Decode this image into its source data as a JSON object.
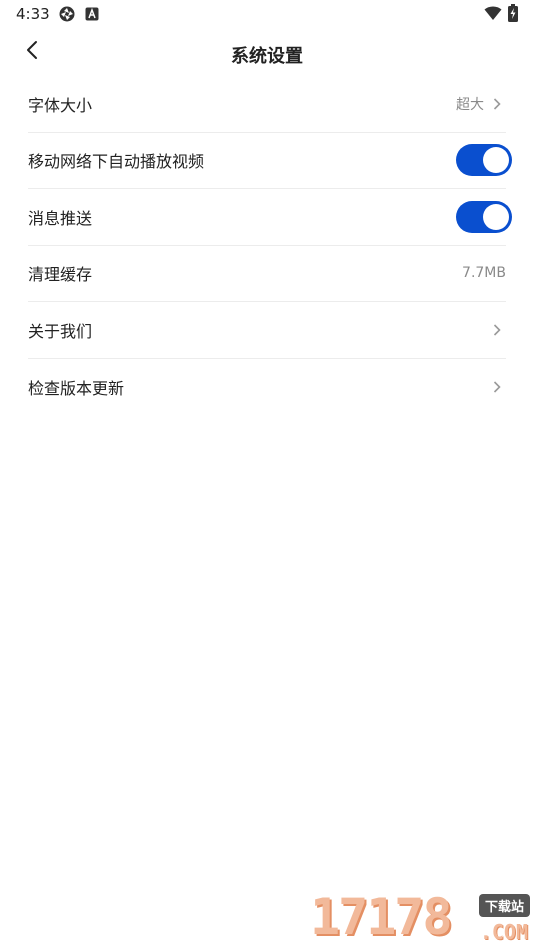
{
  "status_bar": {
    "time": "4:33",
    "icons": [
      "aperture-icon",
      "a-badge-icon",
      "wifi-icon",
      "battery-charging-icon"
    ]
  },
  "header": {
    "back_icon": "chevron-left-icon",
    "title": "系统设置"
  },
  "settings": {
    "items": [
      {
        "label": "字体大小",
        "value": "超大",
        "control": "chevron"
      },
      {
        "label": "移动网络下自动播放视频",
        "control": "toggle",
        "on": true
      },
      {
        "label": "消息推送",
        "control": "toggle",
        "on": true
      },
      {
        "label": "清理缓存",
        "value": "7.7MB",
        "control": "value"
      },
      {
        "label": "关于我们",
        "control": "chevron"
      },
      {
        "label": "检查版本更新",
        "control": "chevron"
      }
    ]
  },
  "colors": {
    "toggle_on": "#0a4fcf",
    "text": "#222222",
    "secondary": "#8a8a8a",
    "divider": "#ececec"
  },
  "watermark": {
    "number": "17178",
    "badge": "下载站",
    "suffix": ".COM"
  }
}
